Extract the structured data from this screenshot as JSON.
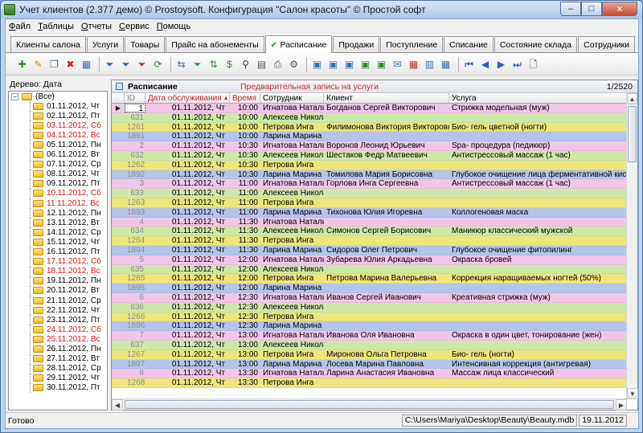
{
  "window": {
    "title": "Учет клиентов (2.377 демо) © Prostoysoft. Конфигурация \"Салон красоты\" © Простой софт",
    "min": "–",
    "max": "□",
    "close": "✕"
  },
  "menu": [
    {
      "pre": "",
      "u": "Ф",
      "post": "айл"
    },
    {
      "pre": "",
      "u": "Т",
      "post": "аблицы"
    },
    {
      "pre": "",
      "u": "О",
      "post": "тчеты"
    },
    {
      "pre": "",
      "u": "С",
      "post": "ервис"
    },
    {
      "pre": "",
      "u": "П",
      "post": "омощь"
    }
  ],
  "tabs": [
    {
      "label": "Клиенты салона",
      "active": false
    },
    {
      "label": "Услуги",
      "active": false
    },
    {
      "label": "Товары",
      "active": false
    },
    {
      "label": "Прайс на абонементы",
      "active": false
    },
    {
      "label": "Расписание",
      "active": true
    },
    {
      "label": "Продажи",
      "active": false
    },
    {
      "label": "Поступление",
      "active": false
    },
    {
      "label": "Списание",
      "active": false
    },
    {
      "label": "Состояние склада",
      "active": false
    },
    {
      "label": "Сотрудники",
      "active": false
    }
  ],
  "toolbar": [
    {
      "icon": "add-record-icon",
      "glyph": "✚",
      "color": "#2f8a2f"
    },
    {
      "icon": "edit-icon",
      "glyph": "✎",
      "color": "#d08a00"
    },
    {
      "icon": "copy-icon",
      "glyph": "❐",
      "color": "#3a6fb0"
    },
    {
      "icon": "delete-icon",
      "glyph": "✖",
      "color": "#d02020"
    },
    {
      "icon": "table-icon",
      "glyph": "▦",
      "color": "#3a6fb0"
    },
    {
      "sep": true
    },
    {
      "icon": "filter-icon",
      "glyph": "⏷",
      "color": "#2a60c0"
    },
    {
      "icon": "filter-add-icon",
      "glyph": "⏷",
      "color": "#2a60c0"
    },
    {
      "icon": "filter-clear-icon",
      "glyph": "⏷",
      "color": "#c03030"
    },
    {
      "icon": "refresh-icon",
      "glyph": "⟳",
      "color": "#2f8a2f"
    },
    {
      "sep": true
    },
    {
      "icon": "export-icon",
      "glyph": "⇆",
      "color": "#3a6fb0"
    },
    {
      "icon": "sort-icon",
      "glyph": "⏷",
      "color": "#2a8a8a"
    },
    {
      "icon": "sort-az-icon",
      "glyph": "⇅",
      "color": "#2f8a2f"
    },
    {
      "icon": "sort-money-icon",
      "glyph": "$",
      "color": "#2f8a2f"
    },
    {
      "icon": "find-icon",
      "glyph": "⚲",
      "color": "#333333"
    },
    {
      "icon": "print-preview-icon",
      "glyph": "▤",
      "color": "#555555"
    },
    {
      "icon": "print-icon",
      "glyph": "⎙",
      "color": "#555555"
    },
    {
      "icon": "settings-icon",
      "glyph": "⚙",
      "color": "#555555"
    },
    {
      "sep": true
    },
    {
      "icon": "view-icon",
      "glyph": "▣",
      "color": "#3a6fb0"
    },
    {
      "icon": "view-icon-2",
      "glyph": "▣",
      "color": "#3a6fb0"
    },
    {
      "icon": "view-icon-3",
      "glyph": "▣",
      "color": "#3a6fb0"
    },
    {
      "icon": "export-word-icon",
      "glyph": "▣",
      "color": "#2f8a2f"
    },
    {
      "icon": "export-excel-icon",
      "glyph": "▣",
      "color": "#2f8a2f"
    },
    {
      "icon": "mail-icon",
      "glyph": "✉",
      "color": "#3a6fb0"
    },
    {
      "icon": "calendar-icon",
      "glyph": "▦",
      "color": "#c03030"
    },
    {
      "icon": "chart-icon",
      "glyph": "▥",
      "color": "#3a6fb0"
    },
    {
      "icon": "grid-icon",
      "glyph": "▦",
      "color": "#3a6fb0"
    },
    {
      "sep": true
    },
    {
      "icon": "first-icon",
      "glyph": "⏮",
      "color": "#2a60c0"
    },
    {
      "icon": "prev-icon",
      "glyph": "◀",
      "color": "#2a60c0"
    },
    {
      "icon": "next-icon",
      "glyph": "▶",
      "color": "#2a60c0"
    },
    {
      "icon": "last-icon",
      "glyph": "⏭",
      "color": "#2a60c0"
    },
    {
      "icon": "new-doc-icon",
      "glyph": "🗋",
      "color": "#333333"
    }
  ],
  "tree": {
    "label": "Дерево: Дата",
    "root": "(Все)",
    "items": [
      {
        "label": "01.11.2012, Чт",
        "red": false
      },
      {
        "label": "02.11.2012, Пт",
        "red": false
      },
      {
        "label": "03.11.2012, Сб",
        "red": true
      },
      {
        "label": "04.11.2012, Вс",
        "red": true
      },
      {
        "label": "05.11.2012, Пн",
        "red": false
      },
      {
        "label": "06.11.2012, Вт",
        "red": false
      },
      {
        "label": "07.11.2012, Ср",
        "red": false
      },
      {
        "label": "08.11.2012, Чт",
        "red": false
      },
      {
        "label": "09.11.2012, Пт",
        "red": false
      },
      {
        "label": "10.11.2012, Сб",
        "red": true
      },
      {
        "label": "11.11.2012, Вс",
        "red": true
      },
      {
        "label": "12.11.2012, Пн",
        "red": false
      },
      {
        "label": "13.11.2012, Вт",
        "red": false
      },
      {
        "label": "14.11.2012, Ср",
        "red": false
      },
      {
        "label": "15.11.2012, Чт",
        "red": false
      },
      {
        "label": "16.11.2012, Пт",
        "red": false
      },
      {
        "label": "17.11.2012, Сб",
        "red": true
      },
      {
        "label": "18.11.2012, Вс",
        "red": true
      },
      {
        "label": "19.11.2012, Пн",
        "red": false
      },
      {
        "label": "20.11.2012, Вт",
        "red": false
      },
      {
        "label": "21.11.2012, Ср",
        "red": false
      },
      {
        "label": "22.11.2012, Чт",
        "red": false
      },
      {
        "label": "23.11.2012, Пт",
        "red": false
      },
      {
        "label": "24.11.2012, Сб",
        "red": true
      },
      {
        "label": "25.11.2012, Вс",
        "red": true
      },
      {
        "label": "26.11.2012, Пн",
        "red": false
      },
      {
        "label": "27.11.2012, Вт",
        "red": false
      },
      {
        "label": "28.11.2012, Ср",
        "red": false
      },
      {
        "label": "29.11.2012, Чт",
        "red": false
      },
      {
        "label": "30.11.2012, Пт",
        "red": false
      }
    ]
  },
  "panel": {
    "title": "Расписание",
    "subtitle": "Предварительная запись на услуги",
    "counter": "1/2520"
  },
  "grid": {
    "columns": [
      "ID",
      "Дата обслуживания",
      "Время",
      "Сотрудник",
      "Клиент",
      "Услуга"
    ],
    "sort_marks": [
      "",
      "▲1",
      "▲2",
      "",
      "",
      ""
    ],
    "staff_colors": {
      "Игнатова Наталья": "#f3c5e8",
      "Алексеев Николай": "#cde9a6",
      "Петрова Инга": "#eee57c",
      "Ларина Марина": "#b4c4ec"
    },
    "rows": [
      {
        "id": "1",
        "date": "01.11.2012, Чт",
        "time": "10:00",
        "staff": "Игнатова Наталья",
        "client": "Богданов Сергей Викторович",
        "service": "Стрижка модельная (муж)"
      },
      {
        "id": "631",
        "date": "01.11.2012, Чт",
        "time": "10:00",
        "staff": "Алексеев Николай",
        "client": "",
        "service": ""
      },
      {
        "id": "1261",
        "date": "01.11.2012, Чт",
        "time": "10:00",
        "staff": "Петрова Инга",
        "client": "Филимонова Виктория Викторовна",
        "service": "Био- гель цветной (ногти)"
      },
      {
        "id": "1891",
        "date": "01.11.2012, Чт",
        "time": "10:00",
        "staff": "Ларина Марина",
        "client": "",
        "service": ""
      },
      {
        "id": "2",
        "date": "01.11.2012, Чт",
        "time": "10:30",
        "staff": "Игнатова Наталья",
        "client": "Воронов Леонид Юрьевич",
        "service": "Spa- процедура (педикюр)"
      },
      {
        "id": "632",
        "date": "01.11.2012, Чт",
        "time": "10:30",
        "staff": "Алексеев Николай",
        "client": "Шестаков Федр Матвеевич",
        "service": "Антистрессовый массаж (1 час)"
      },
      {
        "id": "1262",
        "date": "01.11.2012, Чт",
        "time": "10:30",
        "staff": "Петрова Инга",
        "client": "",
        "service": ""
      },
      {
        "id": "1892",
        "date": "01.11.2012, Чт",
        "time": "10:30",
        "staff": "Ларина Марина",
        "client": "Томилова Мария Борисовна",
        "service": "Глубокое очищение лица ферментативной кислотой"
      },
      {
        "id": "3",
        "date": "01.11.2012, Чт",
        "time": "11:00",
        "staff": "Игнатова Наталья",
        "client": "Горлова Инга Сергеевна",
        "service": "Антистрессовый массаж (1 час)"
      },
      {
        "id": "633",
        "date": "01.11.2012, Чт",
        "time": "11:00",
        "staff": "Алексеев Николай",
        "client": "",
        "service": ""
      },
      {
        "id": "1263",
        "date": "01.11.2012, Чт",
        "time": "11:00",
        "staff": "Петрова Инга",
        "client": "",
        "service": ""
      },
      {
        "id": "1893",
        "date": "01.11.2012, Чт",
        "time": "11:00",
        "staff": "Ларина Марина",
        "client": "Тихонова Юлия Игоревна",
        "service": "Коллогеновая маска"
      },
      {
        "id": "4",
        "date": "01.11.2012, Чт",
        "time": "11:30",
        "staff": "Игнатова Наталья",
        "client": "",
        "service": ""
      },
      {
        "id": "634",
        "date": "01.11.2012, Чт",
        "time": "11:30",
        "staff": "Алексеев Николай",
        "client": "Симонов Сергей Борисович",
        "service": "Маникюр классический мужской"
      },
      {
        "id": "1264",
        "date": "01.11.2012, Чт",
        "time": "11:30",
        "staff": "Петрова Инга",
        "client": "",
        "service": ""
      },
      {
        "id": "1894",
        "date": "01.11.2012, Чт",
        "time": "11:30",
        "staff": "Ларина Марина",
        "client": "Сидоров Олег Петрович",
        "service": "Глубокое очищение фитопилинг"
      },
      {
        "id": "5",
        "date": "01.11.2012, Чт",
        "time": "12:00",
        "staff": "Игнатова Наталья",
        "client": "Зубарева Юлия Аркадьевна",
        "service": "Окраска бровей"
      },
      {
        "id": "635",
        "date": "01.11.2012, Чт",
        "time": "12:00",
        "staff": "Алексеев Николай",
        "client": "",
        "service": ""
      },
      {
        "id": "1265",
        "date": "01.11.2012, Чт",
        "time": "12:00",
        "staff": "Петрова Инга",
        "client": "Петрова Марина Валерьевна",
        "service": "Коррекция наращиваемых ногтей (50%)"
      },
      {
        "id": "1895",
        "date": "01.11.2012, Чт",
        "time": "12:00",
        "staff": "Ларина Марина",
        "client": "",
        "service": ""
      },
      {
        "id": "6",
        "date": "01.11.2012, Чт",
        "time": "12:30",
        "staff": "Игнатова Наталья",
        "client": "Иванов Сергей Иванович",
        "service": "Креативная стрижка (муж)"
      },
      {
        "id": "636",
        "date": "01.11.2012, Чт",
        "time": "12:30",
        "staff": "Алексеев Николай",
        "client": "",
        "service": ""
      },
      {
        "id": "1266",
        "date": "01.11.2012, Чт",
        "time": "12:30",
        "staff": "Петрова Инга",
        "client": "",
        "service": ""
      },
      {
        "id": "1896",
        "date": "01.11.2012, Чт",
        "time": "12:30",
        "staff": "Ларина Марина",
        "client": "",
        "service": ""
      },
      {
        "id": "7",
        "date": "01.11.2012, Чт",
        "time": "13:00",
        "staff": "Игнатова Наталья",
        "client": "Иванова Оля Ивановна",
        "service": "Окраска в один цвет, тонирование (жен)"
      },
      {
        "id": "637",
        "date": "01.11.2012, Чт",
        "time": "13:00",
        "staff": "Алексеев Николай",
        "client": "",
        "service": ""
      },
      {
        "id": "1267",
        "date": "01.11.2012, Чт",
        "time": "13:00",
        "staff": "Петрова Инга",
        "client": "Миронова Ольга Петровна",
        "service": "Био- гель (ногти)"
      },
      {
        "id": "1897",
        "date": "01.11.2012, Чт",
        "time": "13:00",
        "staff": "Ларина Марина",
        "client": "Лосева Марина Павловна",
        "service": "Интенсивная коррекция (антигревая)"
      },
      {
        "id": "8",
        "date": "01.11.2012, Чт",
        "time": "13:30",
        "staff": "Игнатова Наталья",
        "client": "Ларина Анастасия Ивановна",
        "service": "Массаж лица классический"
      },
      {
        "id": "1268",
        "date": "01.11.2012, Чт",
        "time": "13:30",
        "staff": "Петрова Инга",
        "client": "",
        "service": ""
      }
    ]
  },
  "status": {
    "text": "Готово",
    "path": "C:\\Users\\Mariya\\Desktop\\Beauty\\Beauty.mdb",
    "date": "19.11.2012"
  }
}
